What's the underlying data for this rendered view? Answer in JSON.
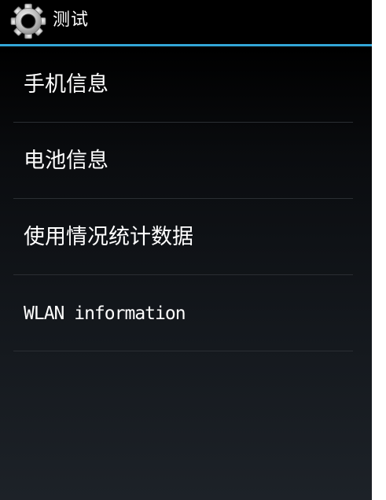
{
  "action_bar": {
    "icon": "gear-icon",
    "title": "测试"
  },
  "list": {
    "items": [
      {
        "label": "手机信息"
      },
      {
        "label": "电池信息"
      },
      {
        "label": "使用情况统计数据"
      },
      {
        "label": "WLAN information"
      }
    ]
  },
  "colors": {
    "accent_divider": "#33a7d8",
    "background_top": "#000000",
    "background_bottom": "#1d2228",
    "text": "#ffffff",
    "item_divider": "#2a2e33"
  }
}
